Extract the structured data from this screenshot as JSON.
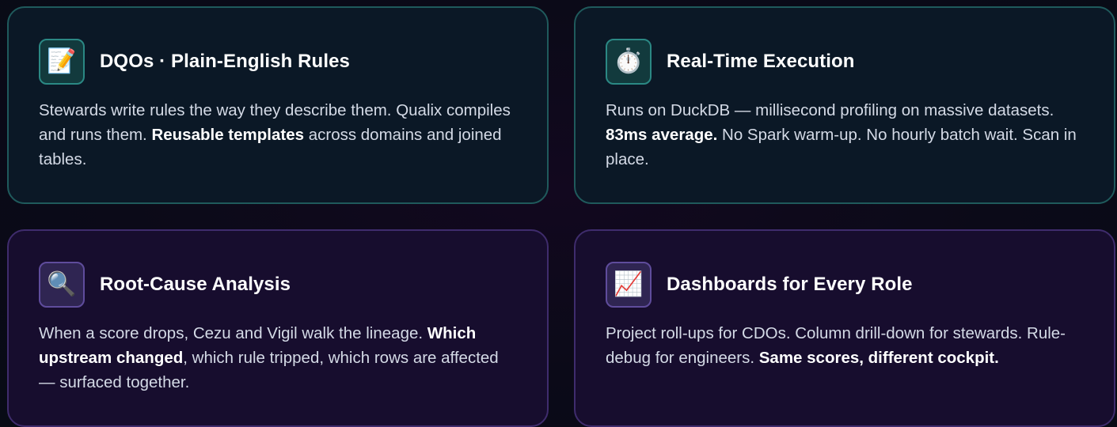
{
  "cards": [
    {
      "icon": "memo-icon",
      "icon_glyph": "📝",
      "title": "DQOs · Plain-English Rules",
      "body": [
        {
          "text": "Stewards write rules the way they describe them. Qualix compiles and runs them. ",
          "bold": false
        },
        {
          "text": "Reusable templates",
          "bold": true
        },
        {
          "text": " across domains and joined tables.",
          "bold": false
        }
      ]
    },
    {
      "icon": "stopwatch-icon",
      "icon_glyph": "⏱️",
      "title": "Real-Time Execution",
      "body": [
        {
          "text": "Runs on DuckDB — millisecond profiling on massive datasets. ",
          "bold": false
        },
        {
          "text": "83ms average.",
          "bold": true
        },
        {
          "text": " No Spark warm-up. No hourly batch wait. Scan in place.",
          "bold": false
        }
      ]
    },
    {
      "icon": "magnifying-glass-icon",
      "icon_glyph": "🔍",
      "title": "Root-Cause Analysis",
      "body": [
        {
          "text": "When a score drops, Cezu and Vigil walk the lineage. ",
          "bold": false
        },
        {
          "text": "Which upstream changed",
          "bold": true
        },
        {
          "text": ", which rule tripped, which rows are affected — surfaced together.",
          "bold": false
        }
      ]
    },
    {
      "icon": "chart-increasing-icon",
      "icon_glyph": "📈",
      "title": "Dashboards for Every Role",
      "body": [
        {
          "text": "Project roll-ups for CDOs. Column drill-down for stewards. Rule-debug for engineers. ",
          "bold": false
        },
        {
          "text": "Same scores, different cockpit.",
          "bold": true
        }
      ]
    }
  ],
  "colors": {
    "teal_border": "#1f5a5c",
    "purple_border": "#3f2c6d",
    "title": "#ffffff",
    "body": "#d4dae6"
  }
}
